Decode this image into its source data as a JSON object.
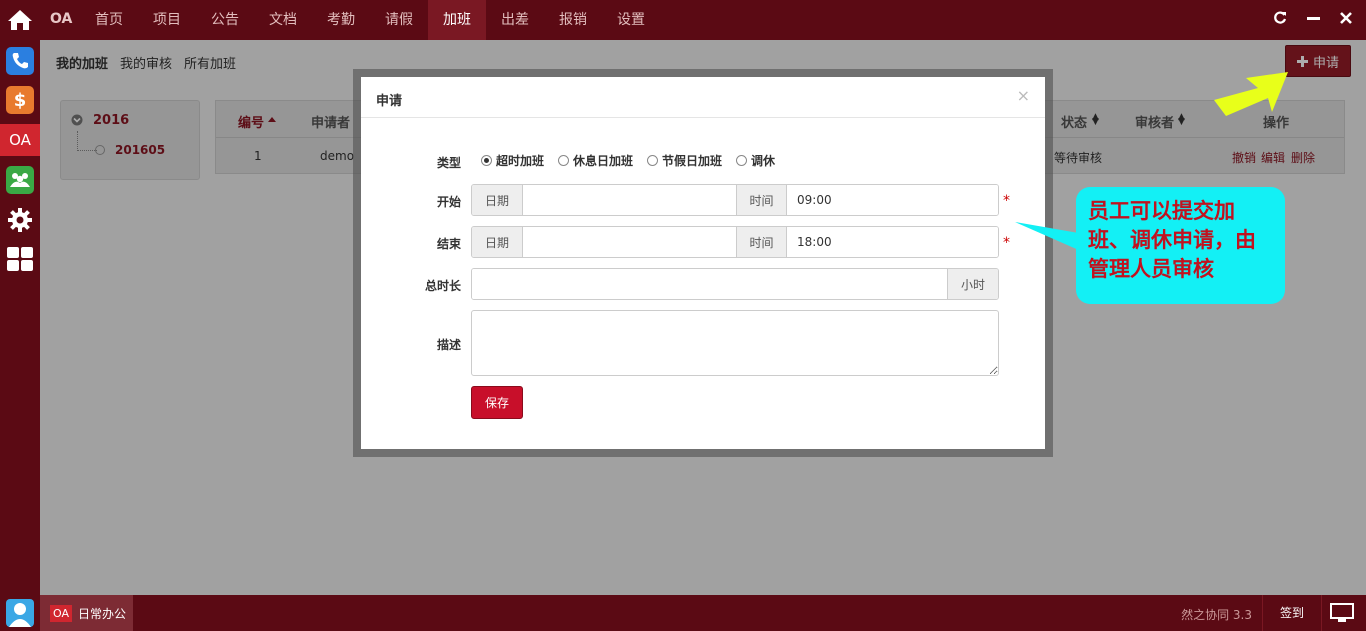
{
  "topbar": {
    "brand": "OA",
    "nav": [
      "首页",
      "项目",
      "公告",
      "文档",
      "考勤",
      "请假",
      "加班",
      "出差",
      "报销",
      "设置"
    ],
    "active_nav": "加班"
  },
  "dock": {
    "oa_label": "OA",
    "dollar_label": "$"
  },
  "subnav": {
    "items": [
      "我的加班",
      "我的审核",
      "所有加班"
    ]
  },
  "apply_button": {
    "label": "申请"
  },
  "tree": {
    "year": "2016",
    "month": "201605"
  },
  "grid": {
    "headers": [
      "编号",
      "申请者",
      "状态",
      "审核者",
      "操作"
    ],
    "row": {
      "id": "1",
      "applicant": "demo",
      "status": "等待审核",
      "actions": [
        "撤销",
        "编辑",
        "删除"
      ]
    }
  },
  "modal": {
    "title": "申请",
    "close": "×",
    "type_label": "类型",
    "types": [
      "超时加班",
      "休息日加班",
      "节假日加班",
      "调休"
    ],
    "selected_type": "超时加班",
    "start_label": "开始",
    "end_label": "结束",
    "date_addon": "日期",
    "time_addon": "时间",
    "start_time": "09:00",
    "end_time": "18:00",
    "duration_label": "总时长",
    "duration_unit": "小时",
    "desc_label": "描述",
    "save_label": "保存",
    "required_mark": "*"
  },
  "callout": {
    "text": "员工可以提交加班、调休申请，由管理人员审核"
  },
  "bottombar": {
    "task_oa": "OA",
    "task_label": "日常办公",
    "version": "然之协同 3.3",
    "signin": "签到"
  },
  "colors": {
    "bar": "#5b0a14",
    "accent": "#c80f2a",
    "callout_bg": "#13f0f5",
    "callout_text": "#c1121f",
    "arrow": "#e8ff1a"
  }
}
